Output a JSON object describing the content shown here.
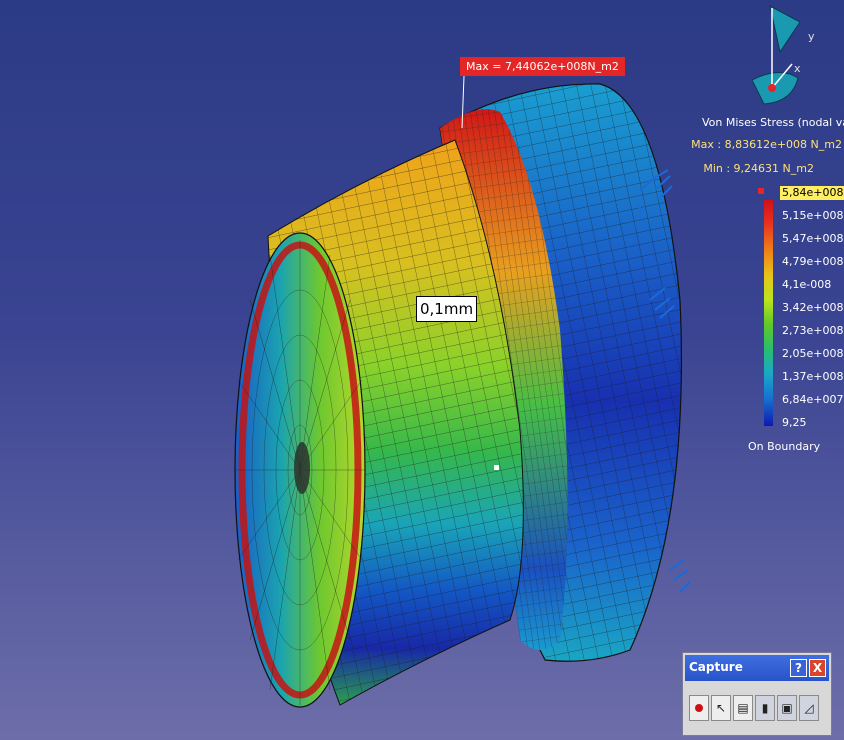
{
  "viewport": {
    "max_label": "Max = 7,44062e+008N_m2",
    "dimension_label": "0,1mm"
  },
  "legend": {
    "title": "Von Mises Stress (nodal values",
    "max": "Max : 8,83612e+008 N_m2",
    "min": "Min : 9,24631 N_m2",
    "ticks": [
      "5,84e+008",
      "5,15e+008",
      "5,47e+008",
      "4,79e+008",
      "4,1e-008",
      "3,42e+008",
      "2,73e+008",
      "2,05e+008",
      "1,37e+008",
      "6,84e+007",
      "9,25"
    ],
    "footer": "On Boundary"
  },
  "compass": {
    "axis_y": "y",
    "axis_x": "x"
  },
  "capture_panel": {
    "title": "Capture",
    "help_label": "?",
    "close_label": "X",
    "tools": [
      "record-icon",
      "select-icon",
      "options-icon",
      "album-icon",
      "image-icon",
      "settings-icon"
    ]
  },
  "colors": {
    "max_tag_bg": "#e52626",
    "legend_text": "#ffe07a",
    "titlebar": "#2853c8"
  }
}
